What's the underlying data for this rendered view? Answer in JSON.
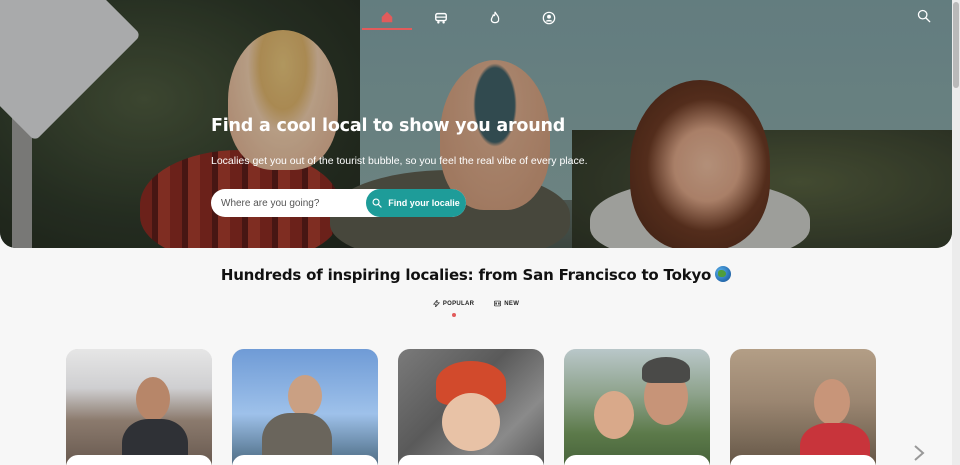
{
  "nav": {
    "items": [
      {
        "icon": "home-icon",
        "active": true
      },
      {
        "icon": "car-icon",
        "active": false
      },
      {
        "icon": "fire-icon",
        "active": false
      },
      {
        "icon": "user-icon",
        "active": false
      }
    ],
    "search_icon": "search-icon",
    "active_color": "#e25b5b"
  },
  "hero": {
    "title": "Find a cool local to show you around",
    "subtitle": "Localies get you out of the tourist bubble, so you feel the real vibe of every place.",
    "search_placeholder": "Where are you going?",
    "button_label": "Find your localie",
    "button_color": "#1e9c99"
  },
  "section": {
    "title": "Hundreds of inspiring localies: from San Francisco to Tokyo",
    "tabs": [
      {
        "label": "POPULAR",
        "icon": "bolt-icon",
        "active": true
      },
      {
        "label": "NEW",
        "icon": "new-icon",
        "active": false
      }
    ]
  },
  "cards": [
    {
      "name": "localie-card-1"
    },
    {
      "name": "localie-card-2"
    },
    {
      "name": "localie-card-3"
    },
    {
      "name": "localie-card-4"
    },
    {
      "name": "localie-card-5"
    }
  ]
}
